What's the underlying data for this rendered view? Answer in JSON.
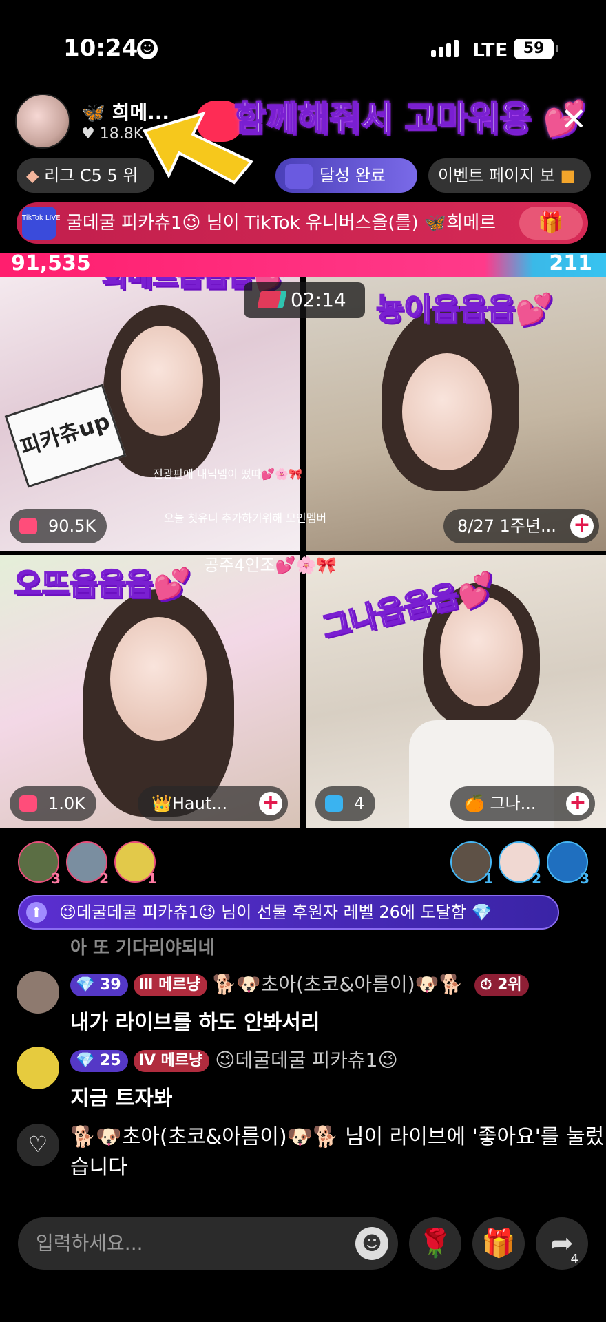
{
  "status": {
    "time": "10:24",
    "network": "LTE",
    "battery": "59"
  },
  "host": {
    "name": "🦋 희메...",
    "likes": "♥ 18.8K"
  },
  "overlay_caption": "함께해줘서 고마워용 💕",
  "pills": {
    "league": "리그 C5 5 위",
    "achievement": "달성 완료",
    "event": "이벤트 페이지 보"
  },
  "notice": {
    "logo": "TikTok LIVE",
    "text": "굴데굴 피카츄1😉 님이 TikTok 유니버스을(를) 🦋희메르"
  },
  "battle": {
    "left_score": "91,535",
    "right_score": "211",
    "timer": "02:14"
  },
  "grid": {
    "cells": [
      {
        "label": "희메르읍읍읍💕",
        "count": "90.5K"
      },
      {
        "label": "뇽이읍읍읍💕",
        "name": "8/27 1주년..."
      },
      {
        "label": "오뜨읍읍읍💕",
        "count": "1.0K",
        "name": "👑Haut..."
      },
      {
        "label": "그나읍읍읍💕",
        "count": "4",
        "name": "🍊 그나..."
      }
    ],
    "captions": [
      "전광판에 내닉넴이 떴따💕🌸🎀",
      "오늘 첫유니 추가하기위해 모인멤버",
      "공주4인조💕🌸🎀"
    ]
  },
  "viewers_left": [
    "3",
    "2",
    "1"
  ],
  "viewers_right": [
    "1",
    "2",
    "3"
  ],
  "levelup": "😉데굴데굴 피카츄1😉 님이 선물 후원자 레벨 26에 도달함 💎",
  "faded_message": "아 또 기다리야되네",
  "chat": [
    {
      "level": "39",
      "fan_badge": "메르냥",
      "user": "🐕🐶초아(초코&아름이)🐶🐕",
      "rank_badge": "2위",
      "message": "내가 라이브를 하도 안봐서리"
    },
    {
      "level": "25",
      "fan_badge": "메르냥",
      "user": "😉데굴데굴 피카츄1😉",
      "message": "지금 트자봐"
    }
  ],
  "like_notice": "🐕🐶초아(초코&아름이)🐶🐕 님이 라이브에 '좋아요'를 눌렀습니다",
  "input": {
    "placeholder": "입력하세요..."
  },
  "share_count": "4",
  "colors": {
    "accent": "#fe2c55",
    "battle_left": "#ff1e6e",
    "battle_right": "#38c3f0",
    "level_badge": "#5538c6"
  }
}
